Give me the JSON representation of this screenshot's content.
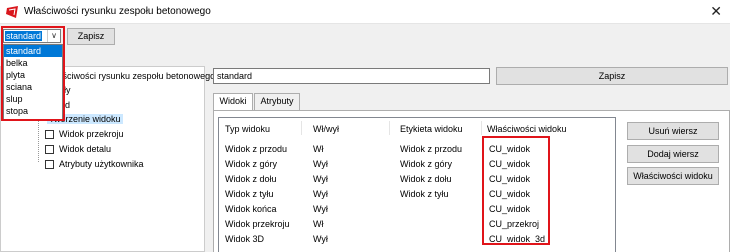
{
  "window": {
    "title": "Właściwości rysunku zespołu betonowego",
    "close_icon": "close-icon"
  },
  "toolbar": {
    "preset_value": "standard",
    "save_label": "Zapisz",
    "preset_options": [
      "standard",
      "belka",
      "plyta",
      "sciana",
      "slup",
      "stopa"
    ]
  },
  "tree": {
    "root": "Właściwości rysunku zespołu betonowego",
    "items": [
      "Tytuły",
      "Układ",
      "Tworzenie widoku",
      "Widok przekroju",
      "Widok detalu",
      "Atrybuty użytkownika"
    ]
  },
  "right": {
    "name_value": "standard",
    "save_label": "Zapisz",
    "tabs": [
      "Widoki",
      "Atrybuty"
    ]
  },
  "grid": {
    "columns": [
      "Typ widoku",
      "Wł/wył",
      "Etykieta widoku",
      "Właściwości widoku"
    ],
    "rows": [
      [
        "Widok z przodu",
        "Wł",
        "Widok z przodu",
        "CU_widok"
      ],
      [
        "Widok z góry",
        "Wył",
        "Widok z góry",
        "CU_widok"
      ],
      [
        "Widok z dołu",
        "Wył",
        "Widok z dołu",
        "CU_widok"
      ],
      [
        "Widok z tyłu",
        "Wył",
        "Widok z tyłu",
        "CU_widok"
      ],
      [
        "Widok końca",
        "Wył",
        "",
        "CU_widok"
      ],
      [
        "Widok przekroju",
        "Wł",
        "",
        "CU_przekroj"
      ],
      [
        "Widok 3D",
        "Wył",
        "",
        "CU_widok_3d"
      ]
    ]
  },
  "buttons": {
    "remove_row": "Usuń wiersz",
    "add_row": "Dodaj wiersz",
    "view_properties": "Właściwości widoku"
  },
  "colors": {
    "highlight_red": "#e0141a",
    "selection_blue": "#0078d7",
    "tree_highlight": "#cce8ff"
  }
}
